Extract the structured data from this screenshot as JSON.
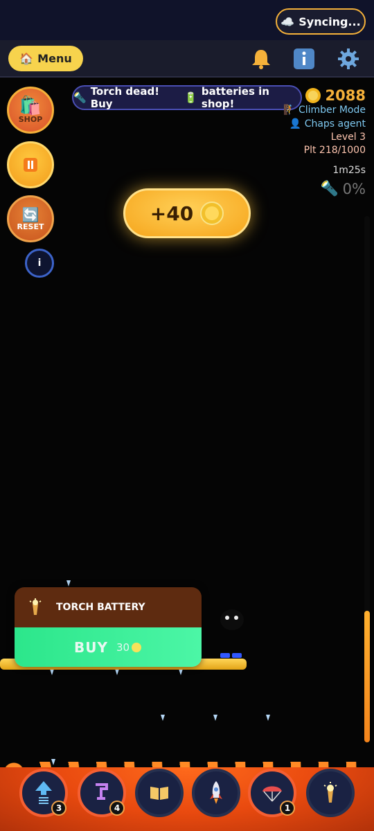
{
  "sync": {
    "label": "Syncing...",
    "icon": "cloud-icon"
  },
  "navbar": {
    "menu_label": "Menu",
    "icons": [
      "bell-icon",
      "info-icon",
      "gear-icon"
    ]
  },
  "left_buttons": {
    "shop_label": "SHOP",
    "reset_label": "RESET",
    "info_label": "i"
  },
  "banner": {
    "text_part1": "Torch dead! Buy",
    "text_part2": "batteries in shop!"
  },
  "stats": {
    "coins": "2088",
    "mode": "Climber Mode",
    "agent": "Chaps agent",
    "level": "Level 3",
    "plt": "Plt 218/1000",
    "timer": "1m25s",
    "torch_percent": "0%"
  },
  "reward": {
    "amount": "+40"
  },
  "card": {
    "title": "TORCH BATTERY",
    "buy_label": "BUY",
    "price": "30"
  },
  "tools": [
    {
      "name": "spring-jump",
      "count": "3"
    },
    {
      "name": "grapple-hook",
      "count": "4"
    },
    {
      "name": "book",
      "count": ""
    },
    {
      "name": "rocket",
      "count": ""
    },
    {
      "name": "parachute",
      "count": "1"
    },
    {
      "name": "torch",
      "count": ""
    }
  ],
  "progress": {
    "level": 0.25
  },
  "colors": {
    "accent": "#f5b13a",
    "lava": "#e94a0f",
    "buy": "#2ce68b"
  }
}
